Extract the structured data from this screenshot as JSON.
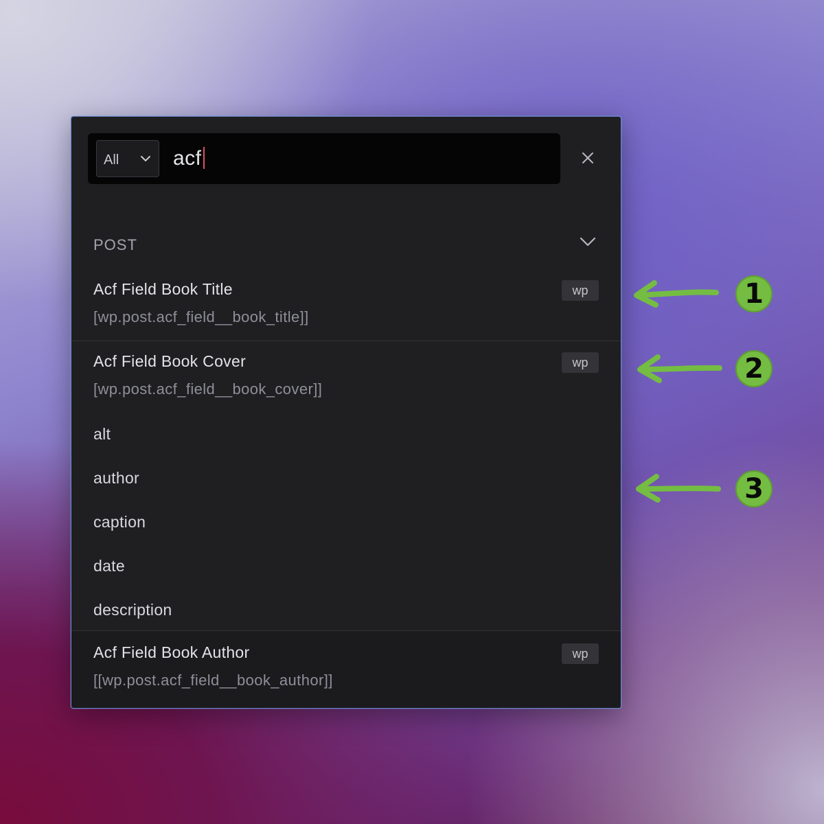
{
  "search": {
    "scope": "All",
    "query": "acf"
  },
  "section": {
    "title": "POST"
  },
  "results": [
    {
      "title": "Acf Field Book Title",
      "path": "[wp.post.acf_field__book_title]]",
      "badge": "wp"
    },
    {
      "title": "Acf Field Book Cover",
      "path": "[wp.post.acf_field__book_cover]]",
      "badge": "wp",
      "children": [
        "alt",
        "author",
        "caption",
        "date",
        "description"
      ]
    },
    {
      "title": "Acf Field Book Author",
      "path": "[[wp.post.acf_field__book_author]]",
      "badge": "wp"
    }
  ],
  "annotations": [
    "1",
    "2",
    "3"
  ],
  "colors": {
    "panel_bg": "#1f1f22",
    "accent_border": "#6b86c9",
    "caret": "#e0506a",
    "annotation_green": "#74bd42"
  },
  "icons": [
    "chevron-down-icon",
    "close-icon",
    "arrow-left-icon"
  ]
}
